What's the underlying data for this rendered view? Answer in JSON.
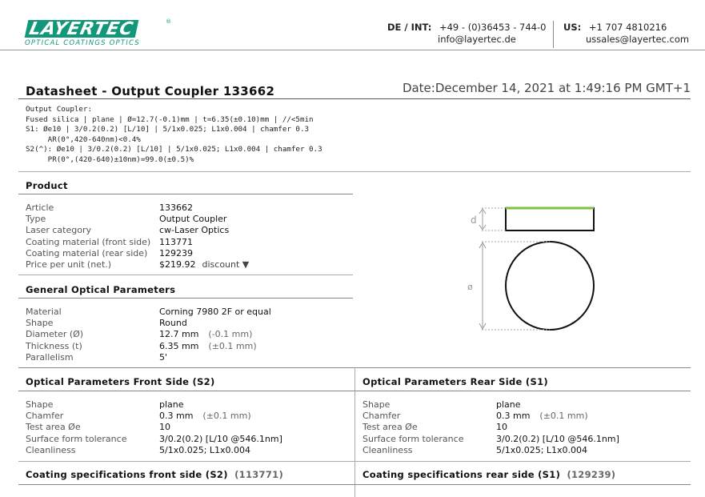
{
  "logo": {
    "name": "LAYERTEC",
    "tagline": "OPTICAL COATINGS OPTICS",
    "registered": "®"
  },
  "contact_de": {
    "label": "DE / INT:",
    "phone": "+49 - (0)36453 - 744-0",
    "email": "info@layertec.de"
  },
  "contact_us": {
    "label": "US:",
    "phone": "+1 707 4810216",
    "email": "ussales@layertec.com"
  },
  "title": "Datasheet - Output Coupler 133662",
  "date": "Date:December 14, 2021 at 1:49:16 PM GMT+1",
  "spec_lines": [
    "Output Coupler:",
    "Fused silica | plane | Ø=12.7(-0.1)mm | t=6.35(±0.10)mm | //<5min",
    "S1: Øe10 | 3/0.2(0.2) [L/10] | 5/1x0.025; L1x0.004 | chamfer 0.3",
    "     AR(0°,420-640nm)<0.4%",
    "S2(^): Øe10 | 3/0.2(0.2) [L/10] | 5/1x0.025; L1x0.004 | chamfer 0.3",
    "     PR(0°,(420-640)±10nm)=99.0(±0.5)%"
  ],
  "product": {
    "title": "Product",
    "rows": [
      {
        "label": "Article",
        "value": "133662"
      },
      {
        "label": "Type",
        "value": "Output Coupler"
      },
      {
        "label": "Laser category",
        "value": "cw-Laser Optics"
      },
      {
        "label": "Coating material (front side)",
        "value": "113771"
      },
      {
        "label": "Coating material (rear side)",
        "value": "129239"
      }
    ],
    "price_label": "Price per unit (net.)",
    "price_value": "$219.92",
    "discount_label": "discount ▼"
  },
  "general": {
    "title": "General Optical Parameters",
    "rows": [
      {
        "label": "Material",
        "value": "Corning 7980 2F or equal",
        "tol": ""
      },
      {
        "label": "Shape",
        "value": "Round",
        "tol": ""
      },
      {
        "label": "Diameter (Ø)",
        "value": "12.7 mm",
        "tol": "(-0.1 mm)"
      },
      {
        "label": "Thickness (t)",
        "value": "6.35 mm",
        "tol": "(±0.1 mm)"
      },
      {
        "label": "Parallelism",
        "value": "5'",
        "tol": ""
      }
    ]
  },
  "front": {
    "title": "Optical Parameters Front Side  (S2)",
    "rows": [
      {
        "label": "Shape",
        "value": "plane",
        "tol": ""
      },
      {
        "label": "Chamfer",
        "value": "0.3 mm",
        "tol": "(±0.1 mm)"
      },
      {
        "label": "Test area Øe",
        "value": "10",
        "tol": ""
      },
      {
        "label": "Surface form tolerance",
        "value": "3/0.2(0.2) [L/10 @546.1nm]",
        "tol": ""
      },
      {
        "label": "Cleanliness",
        "value": "5/1x0.025; L1x0.004",
        "tol": ""
      }
    ]
  },
  "rear": {
    "title": "Optical Parameters Rear Side  (S1)",
    "rows": [
      {
        "label": "Shape",
        "value": "plane",
        "tol": ""
      },
      {
        "label": "Chamfer",
        "value": "0.3 mm",
        "tol": "(±0.1 mm)"
      },
      {
        "label": "Test area Øe",
        "value": "10",
        "tol": ""
      },
      {
        "label": "Surface form tolerance",
        "value": "3/0.2(0.2) [L/10 @546.1nm]",
        "tol": ""
      },
      {
        "label": "Cleanliness",
        "value": "5/1x0.025; L1x0.004",
        "tol": ""
      }
    ]
  },
  "coating_front": {
    "title": "Coating specifications front side  (S2)",
    "code": "(113771)"
  },
  "coating_rear": {
    "title": "Coating specifications rear side  (S1)",
    "code": "(129239)"
  },
  "drawing": {
    "thickness_label": "d",
    "diameter_label": "ø",
    "coating_color": "#7dc242"
  }
}
